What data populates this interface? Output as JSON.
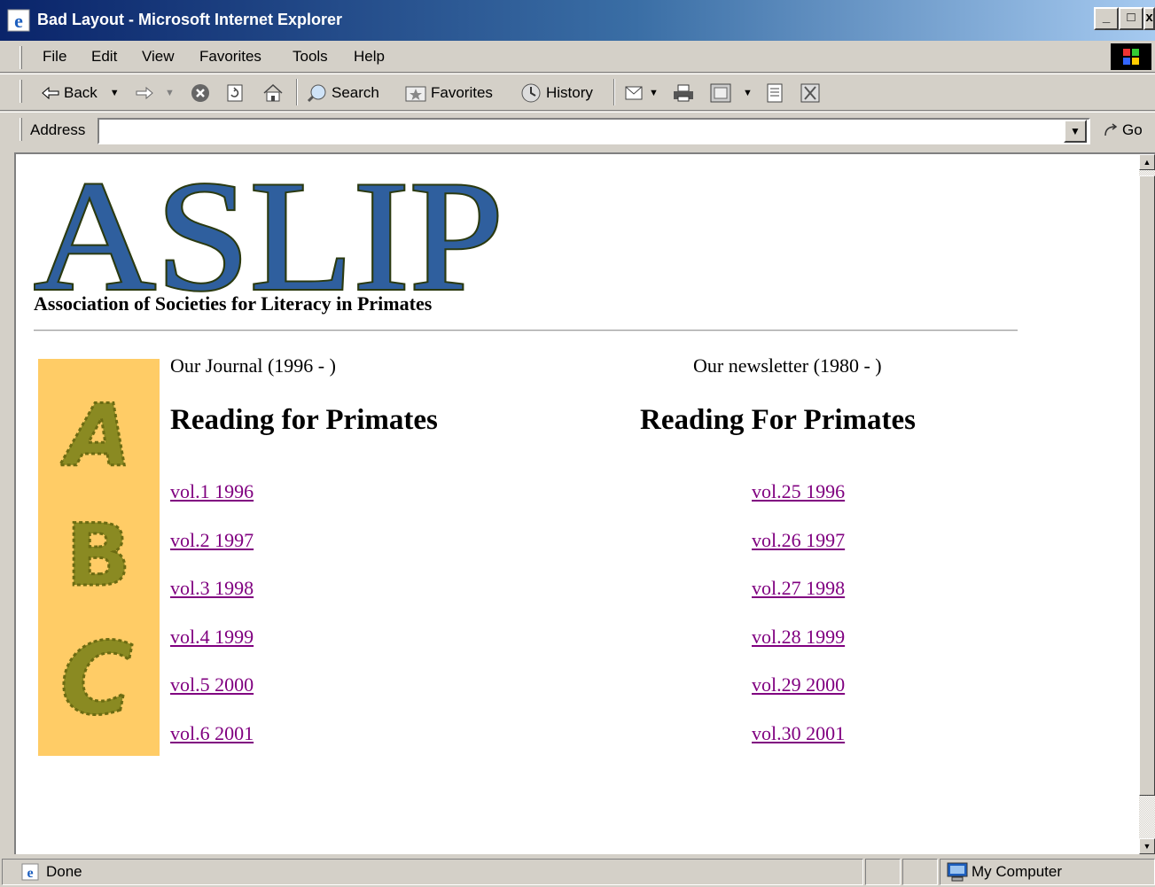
{
  "window": {
    "title": "Bad Layout - Microsoft Internet Explorer",
    "min_label": "_",
    "max_label": "□",
    "close_label": "x"
  },
  "menu": {
    "items": [
      "File",
      "Edit",
      "View",
      "Favorites",
      "Tools",
      "Help"
    ]
  },
  "toolbar": {
    "back_label": "Back",
    "search_label": "Search",
    "favorites_label": "Favorites",
    "history_label": "History",
    "icons": [
      "back-arrow-icon",
      "forward-arrow-icon",
      "stop-icon",
      "refresh-icon",
      "home-icon",
      "search-icon",
      "favorites-icon",
      "history-icon",
      "mail-icon",
      "print-icon",
      "edit-icon",
      "discuss-icon",
      "messenger-icon"
    ]
  },
  "address": {
    "label": "Address",
    "value": "",
    "go_label": "Go"
  },
  "page": {
    "logo_text": "ASLIP",
    "logo_subtitle": "Association of Societies for Literacy in Primates",
    "abc_image_text": "ABC",
    "journal": {
      "caption": "Our Journal (1996 - )",
      "heading": "Reading for Primates",
      "links": [
        "vol.1 1996",
        "vol.2 1997",
        "vol.3 1998",
        "vol.4 1999",
        "vol.5 2000",
        "vol.6 2001"
      ]
    },
    "newsletter": {
      "caption": "Our newsletter (1980 - )",
      "heading": "Reading For Primates",
      "links": [
        "vol.25 1996",
        "vol.26 1997",
        "vol.27 1998",
        "vol.28 1999",
        "vol.29 2000",
        "vol.30 2001"
      ]
    }
  },
  "status": {
    "text": "Done",
    "zone": "My Computer"
  },
  "colors": {
    "logo_fill": "#2f5f9e",
    "logo_outline": "#2b3a10",
    "abc_background": "#ffcc66",
    "abc_letters": "#7a7a1a",
    "visited_link": "#800080",
    "titlebar_start": "#0a246a",
    "titlebar_end": "#a6caf0"
  }
}
